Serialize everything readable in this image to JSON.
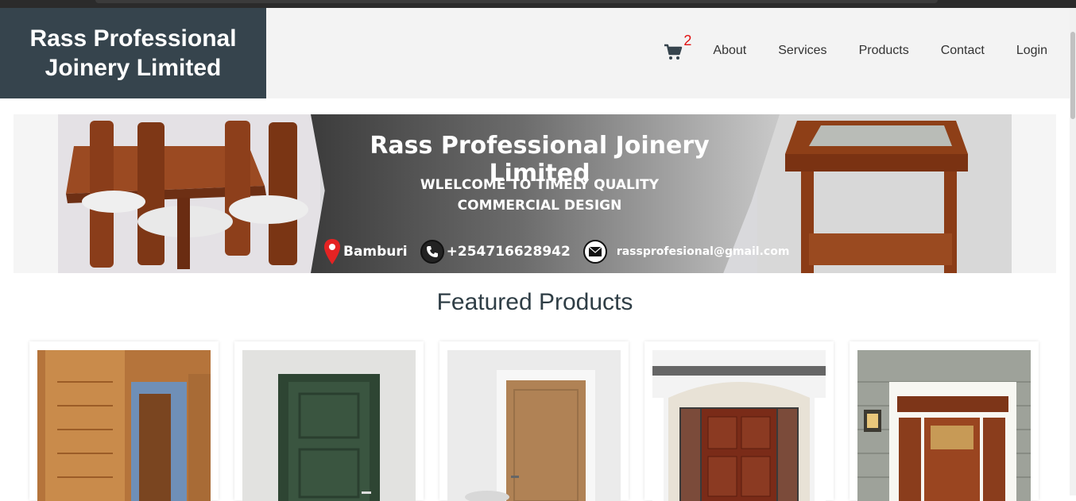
{
  "header": {
    "brand_line1": "Rass Professional",
    "brand_line2": "Joinery Limited",
    "cart_icon": "cart-icon",
    "cart_count": "2",
    "nav": [
      "About",
      "Services",
      "Products",
      "Contact",
      "Login"
    ]
  },
  "banner": {
    "title": "Rass Professional Joinery Limited",
    "subtitle_line1": "WLELCOME TO TIMELY QUALITY",
    "subtitle_line2": "COMMERCIAL DESIGN",
    "location": "Bamburi",
    "phone": "+254716628942",
    "email": "rassprofesional@gmail.com"
  },
  "featured": {
    "title": "Featured Products"
  },
  "colors": {
    "brand_bg": "#36444d",
    "header_bg": "#f3f3f3",
    "cart_badge": "#e01010"
  }
}
